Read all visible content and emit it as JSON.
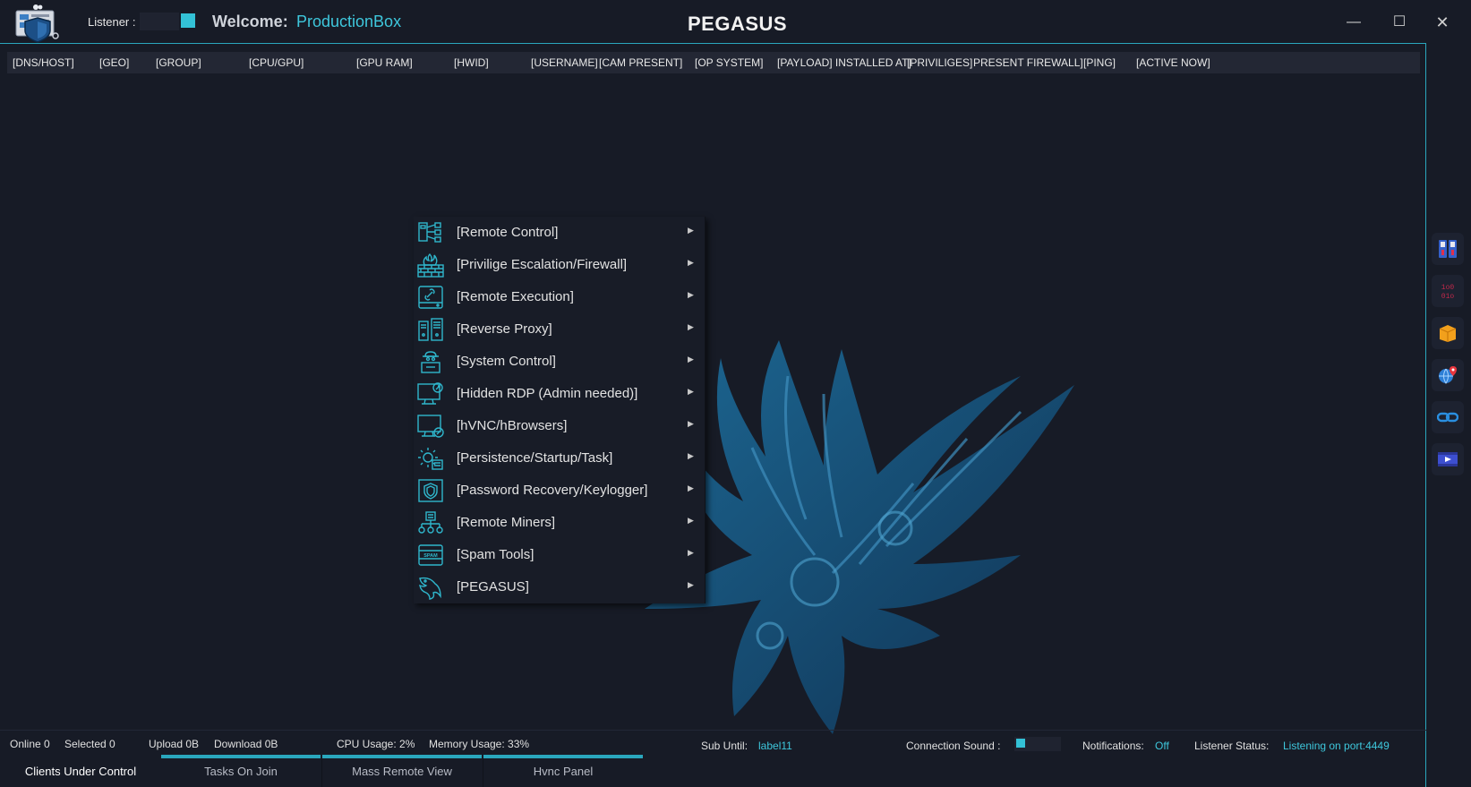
{
  "titlebar": {
    "listener_label": "Listener :",
    "welcome_label": "Welcome:",
    "username": "ProductionBox",
    "app_title": "PEGASUS",
    "minimize": "—",
    "maximize": "☐",
    "close": "✕"
  },
  "columns": [
    "[DNS/HOST]",
    "[GEO]",
    "[GROUP]",
    "[CPU/GPU]",
    "[GPU RAM]",
    "[HWID]",
    "[USERNAME]",
    "[CAM PRESENT]",
    "[OP SYSTEM]",
    "[PAYLOAD] INSTALLED AT]",
    "[PRIVILIGES]",
    "PRESENT FIREWALL]",
    "[PING]",
    "[ACTIVE NOW]"
  ],
  "context_menu": {
    "items": [
      {
        "label": "[Remote Control]",
        "icon": "remote-control-icon"
      },
      {
        "label": "[Privilige Escalation/Firewall]",
        "icon": "firewall-icon"
      },
      {
        "label": "[Remote Execution]",
        "icon": "remote-execution-icon"
      },
      {
        "label": "[Reverse Proxy]",
        "icon": "reverse-proxy-icon"
      },
      {
        "label": "[System Control]",
        "icon": "system-control-icon"
      },
      {
        "label": "[Hidden RDP (Admin needed)]",
        "icon": "hidden-rdp-icon"
      },
      {
        "label": "[hVNC/hBrowsers]",
        "icon": "hvnc-icon"
      },
      {
        "label": "[Persistence/Startup/Task]",
        "icon": "persistence-gear-icon"
      },
      {
        "label": "[Password Recovery/Keylogger]",
        "icon": "password-shield-icon"
      },
      {
        "label": "[Remote Miners]",
        "icon": "miners-network-icon"
      },
      {
        "label": "[Spam Tools]",
        "icon": "spam-icon"
      },
      {
        "label": "[PEGASUS]",
        "icon": "pegasus-icon"
      }
    ],
    "spam_icon_text": "SPAM",
    "submenu_arrow": "▶"
  },
  "side_tools": [
    "file-cabinet-icon",
    "binary-icon",
    "package-box-icon",
    "globe-pin-icon",
    "link-icon",
    "video-player-icon"
  ],
  "binary_text": [
    "1o0",
    "01o"
  ],
  "status": {
    "online": "Online 0",
    "selected": "Selected 0",
    "upload": "Upload 0B",
    "download": "Download  0B",
    "cpu": "CPU Usage: 2%",
    "memory": "Memory Usage: 33%",
    "sub_label": "Sub Until:",
    "sub_value": "label11",
    "sound_label": "Connection Sound :",
    "notifications_label": "Notifications:",
    "notifications_value": "Off",
    "listener_status_label": "Listener Status:",
    "listener_status_value": "Listening on port:4449"
  },
  "tabs": [
    "Clients Under Control",
    "Tasks On Join",
    "Mass Remote View",
    "Hvnc Panel"
  ],
  "colors": {
    "accent": "#2aa7bd",
    "cyan_text": "#3ec7dc",
    "background": "#171b26"
  }
}
